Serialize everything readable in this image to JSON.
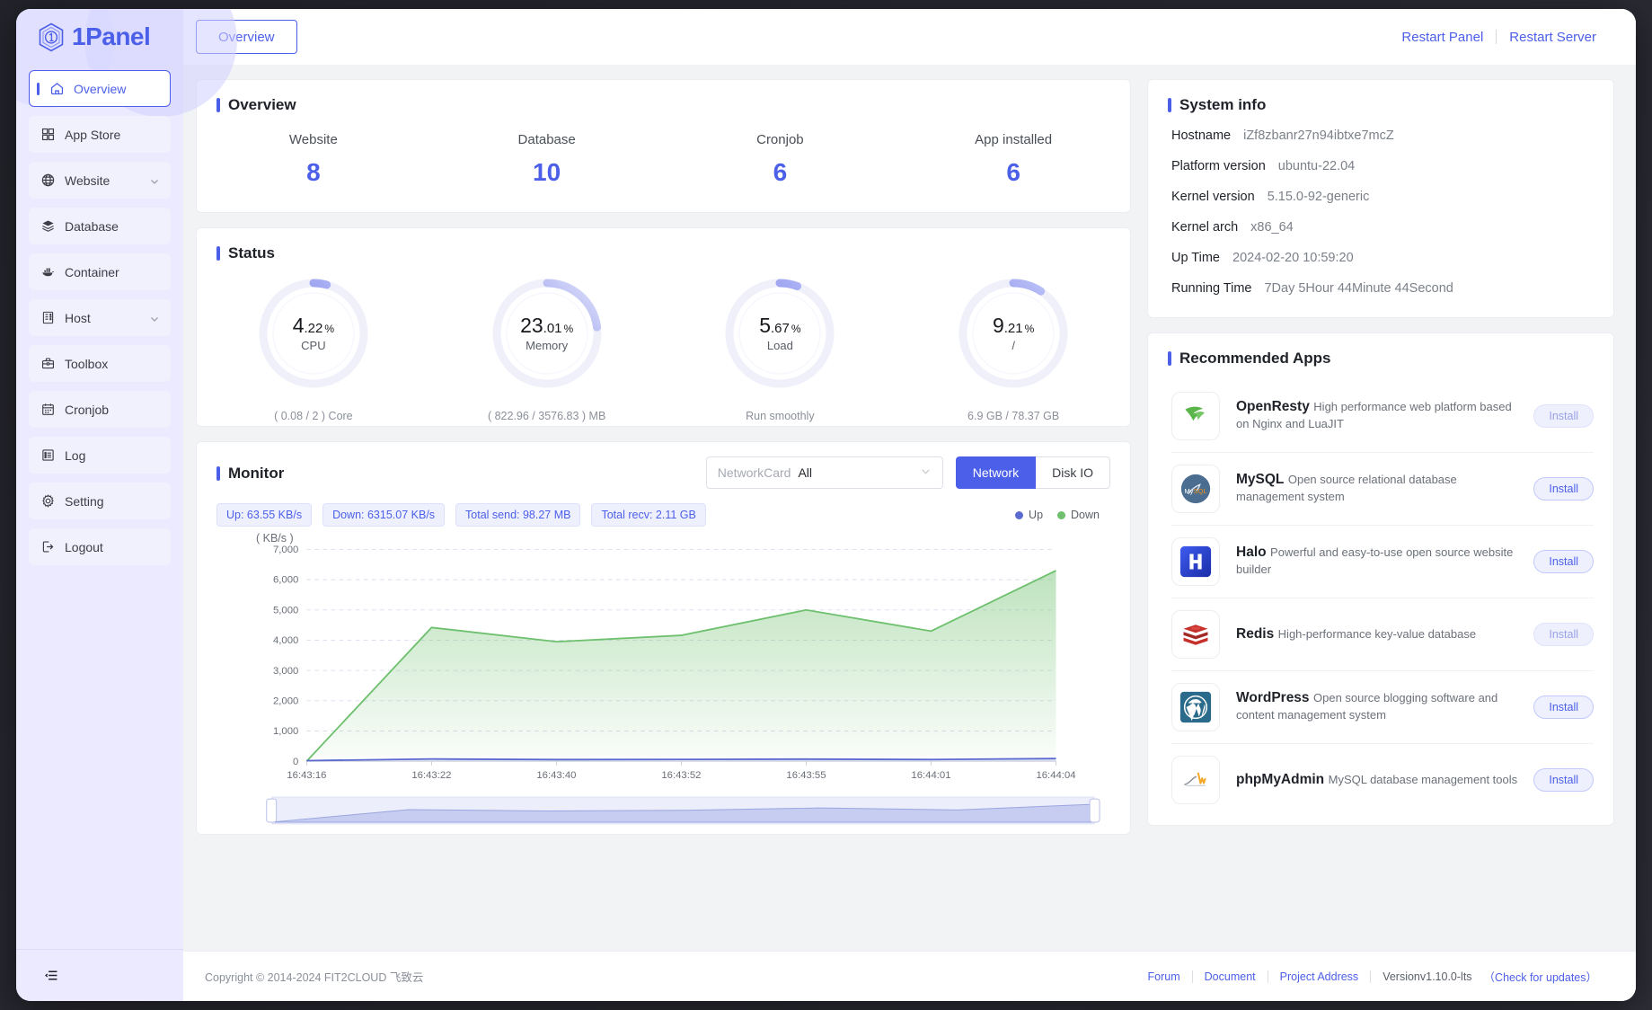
{
  "brand": {
    "name": "1Panel",
    "logo_icon": "hexagon-one-logo-icon"
  },
  "sidebar": {
    "items": [
      {
        "label": "Overview",
        "icon": "home-icon",
        "active": true,
        "expandable": false
      },
      {
        "label": "App Store",
        "icon": "grid-apps-icon",
        "active": false,
        "expandable": false
      },
      {
        "label": "Website",
        "icon": "globe-icon",
        "active": false,
        "expandable": true
      },
      {
        "label": "Database",
        "icon": "database-layers-icon",
        "active": false,
        "expandable": false
      },
      {
        "label": "Container",
        "icon": "docker-whale-icon",
        "active": false,
        "expandable": false
      },
      {
        "label": "Host",
        "icon": "server-icon",
        "active": false,
        "expandable": true
      },
      {
        "label": "Toolbox",
        "icon": "toolbox-icon",
        "active": false,
        "expandable": false
      },
      {
        "label": "Cronjob",
        "icon": "calendar-icon",
        "active": false,
        "expandable": false
      },
      {
        "label": "Log",
        "icon": "list-document-icon",
        "active": false,
        "expandable": false
      },
      {
        "label": "Setting",
        "icon": "gear-icon",
        "active": false,
        "expandable": false
      },
      {
        "label": "Logout",
        "icon": "logout-arrow-icon",
        "active": false,
        "expandable": false
      }
    ],
    "collapse_icon": "collapse-sidebar-icon"
  },
  "topbar": {
    "tab": "Overview",
    "restart_panel": "Restart Panel",
    "restart_server": "Restart Server"
  },
  "overview": {
    "title": "Overview",
    "stats": [
      {
        "label": "Website",
        "value": "8"
      },
      {
        "label": "Database",
        "value": "10"
      },
      {
        "label": "Cronjob",
        "value": "6"
      },
      {
        "label": "App installed",
        "value": "6"
      }
    ]
  },
  "status": {
    "title": "Status",
    "gauges": [
      {
        "int": "4",
        "dec": ".22",
        "pct": "%",
        "name": "CPU",
        "sub": "( 0.08 / 2 ) Core",
        "percent": 4.22
      },
      {
        "int": "23",
        "dec": ".01",
        "pct": "%",
        "name": "Memory",
        "sub": "( 822.96 / 3576.83 ) MB",
        "percent": 23.01
      },
      {
        "int": "5",
        "dec": ".67",
        "pct": "%",
        "name": "Load",
        "sub": "Run smoothly",
        "percent": 5.67
      },
      {
        "int": "9",
        "dec": ".21",
        "pct": "%",
        "name": "/",
        "sub": "6.9 GB / 78.37 GB",
        "percent": 9.21
      }
    ]
  },
  "monitor": {
    "title": "Monitor",
    "select": {
      "prefix": "NetworkCard",
      "value": "All",
      "chevron_icon": "chevron-down-icon"
    },
    "segments": [
      {
        "label": "Network",
        "active": true
      },
      {
        "label": "Disk IO",
        "active": false
      }
    ],
    "tags": [
      "Up: 63.55 KB/s",
      "Down: 6315.07 KB/s",
      "Total send: 98.27 MB",
      "Total recv: 2.11 GB"
    ],
    "legend": [
      {
        "label": "Up",
        "color": "#5b6ad0"
      },
      {
        "label": "Down",
        "color": "#6ec06e"
      }
    ]
  },
  "chart_data": {
    "type": "area",
    "title": "Monitor",
    "xlabel": "",
    "ylabel": "( KB/s )",
    "unit": "( KB/s )",
    "x": [
      "16:43:16",
      "16:43:22",
      "16:43:40",
      "16:43:52",
      "16:43:55",
      "16:44:01",
      "16:44:04"
    ],
    "yticks": [
      "0",
      "1,000",
      "2,000",
      "3,000",
      "4,000",
      "5,000",
      "6,000",
      "7,000"
    ],
    "ylim": [
      0,
      7000
    ],
    "grid": true,
    "legend_position": "top-right",
    "series": [
      {
        "name": "Up",
        "color": "#5b6ad0",
        "values": [
          20,
          75,
          55,
          60,
          70,
          58,
          90
        ]
      },
      {
        "name": "Down",
        "color": "#6ec06e",
        "values": [
          0,
          4420,
          3950,
          4160,
          5000,
          4300,
          6300
        ]
      }
    ]
  },
  "system_info": {
    "title": "System info",
    "rows": [
      {
        "key": "Hostname",
        "value": "iZf8zbanr27n94ibtxe7mcZ"
      },
      {
        "key": "Platform version",
        "value": "ubuntu-22.04"
      },
      {
        "key": "Kernel version",
        "value": "5.15.0-92-generic"
      },
      {
        "key": "Kernel arch",
        "value": "x86_64"
      },
      {
        "key": "Up Time",
        "value": "2024-02-20 10:59:20"
      },
      {
        "key": "Running Time",
        "value": "7Day 5Hour 44Minute 44Second"
      }
    ]
  },
  "recommended_apps": {
    "title": "Recommended Apps",
    "items": [
      {
        "name": "OpenResty",
        "desc": "High performance web platform based on Nginx and LuaJIT",
        "install": "Install",
        "icon": "openresty-icon",
        "muted": true
      },
      {
        "name": "MySQL",
        "desc": "Open source relational database management system",
        "install": "Install",
        "icon": "mysql-icon",
        "muted": false
      },
      {
        "name": "Halo",
        "desc": "Powerful and easy-to-use open source website builder",
        "install": "Install",
        "icon": "halo-icon",
        "muted": false
      },
      {
        "name": "Redis",
        "desc": "High-performance key-value database",
        "install": "Install",
        "icon": "redis-icon",
        "muted": true
      },
      {
        "name": "WordPress",
        "desc": "Open source blogging software and content management system",
        "install": "Install",
        "icon": "wordpress-icon",
        "muted": false
      },
      {
        "name": "phpMyAdmin",
        "desc": "MySQL database management tools",
        "install": "Install",
        "icon": "phpmyadmin-icon",
        "muted": false
      }
    ]
  },
  "footer": {
    "copyright": "Copyright © 2014-2024 FIT2CLOUD 飞致云",
    "links": [
      "Forum",
      "Document",
      "Project Address"
    ],
    "version": "Versionv1.10.0-lts",
    "check_updates": "（Check for updates）"
  },
  "colors": {
    "accent": "#4c5fe8",
    "sidebar_bg": "#eceaff",
    "up": "#5b6ad0",
    "down": "#6ec06e"
  }
}
